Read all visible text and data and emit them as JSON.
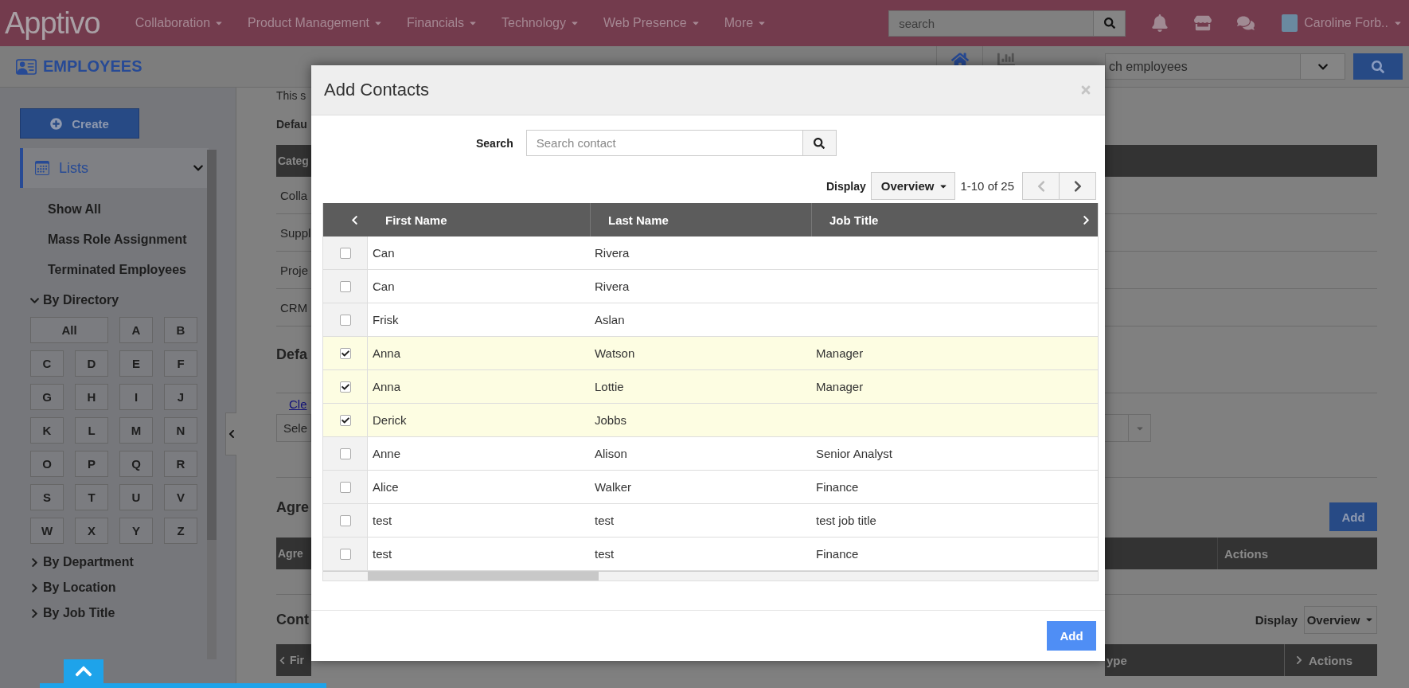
{
  "top_bar": {
    "logo": "Apptivo",
    "menu": [
      "Collaboration",
      "Product Management",
      "Financials",
      "Technology",
      "Web Presence",
      "More"
    ],
    "search": {
      "placeholder": "search"
    },
    "user": "Caroline Forb.."
  },
  "module_bar": {
    "title": "EMPLOYEES",
    "search": {
      "placeholder": "ch employees"
    }
  },
  "sidebar": {
    "create": "Create",
    "lists": {
      "label": "Lists",
      "expanded": true
    },
    "items": [
      "Show All",
      "Mass Role Assignment",
      "Terminated Employees"
    ],
    "groups": [
      {
        "label": "By Directory",
        "expanded": true,
        "letters": [
          "All",
          "A",
          "B",
          "C",
          "D",
          "E",
          "F",
          "G",
          "H",
          "I",
          "J",
          "K",
          "L",
          "M",
          "N",
          "O",
          "P",
          "Q",
          "R",
          "S",
          "T",
          "U",
          "V",
          "W",
          "X",
          "Y",
          "Z"
        ]
      },
      {
        "label": "By Department",
        "expanded": false
      },
      {
        "label": "By Location",
        "expanded": false
      },
      {
        "label": "By Job Title",
        "expanded": false
      }
    ]
  },
  "background": {
    "left": {
      "intro": "This s",
      "default_label": "Defau",
      "table_header": "Categ",
      "rows": [
        "Colla",
        "Suppl",
        "Proje",
        "CRM"
      ],
      "section_1": "Defa",
      "link": "Cle",
      "select": "Sele",
      "section_2": "Agre",
      "table2_header": "Agre",
      "section_3": "Cont",
      "table3_header": "Fir"
    },
    "right": {
      "add": "Add",
      "actions": "Actions",
      "display": "Display",
      "display_value": "Overview",
      "table3_column": "ype",
      "table3_actions": "Actions"
    }
  },
  "modal": {
    "title": "Add Contacts",
    "search": {
      "label": "Search",
      "placeholder": "Search contact"
    },
    "display": {
      "label": "Display",
      "value": "Overview"
    },
    "pagination": "1-10 of 25",
    "columns": [
      "First Name",
      "Last Name",
      "Job Title"
    ],
    "rows": [
      {
        "first_name": "Can",
        "last_name": "Rivera",
        "checked": false
      },
      {
        "first_name": "Can",
        "last_name": "Rivera",
        "checked": false
      },
      {
        "first_name": "Frisk",
        "last_name": "Aslan",
        "checked": false
      },
      {
        "first_name": "Anna",
        "last_name": "Watson",
        "job_title": "Manager",
        "checked": true
      },
      {
        "first_name": "Anna",
        "last_name": "Lottie",
        "job_title": "Manager",
        "checked": true
      },
      {
        "first_name": "Derick",
        "last_name": "Jobbs",
        "checked": true
      },
      {
        "first_name": "Anne",
        "last_name": "Alison",
        "job_title": "Senior Analyst",
        "checked": false
      },
      {
        "first_name": "Alice",
        "last_name": "Walker",
        "job_title": "Finance",
        "checked": false
      },
      {
        "first_name": "test",
        "last_name": "test",
        "job_title": "test job title",
        "checked": false
      },
      {
        "first_name": "test",
        "last_name": "test",
        "job_title": "Finance",
        "checked": false
      }
    ],
    "add": "Add"
  }
}
